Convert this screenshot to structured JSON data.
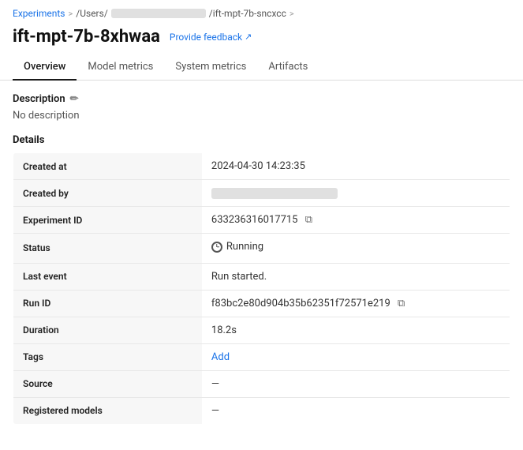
{
  "breadcrumb": {
    "experiments_label": "Experiments",
    "users_label": "/Users/",
    "run_label": "/ift-mpt-7b-sncxcc",
    "sep1": ">",
    "sep2": ">"
  },
  "header": {
    "title": "ift-mpt-7b-8xhwaa",
    "feedback_label": "Provide feedback",
    "feedback_icon": "↗"
  },
  "tabs": [
    {
      "label": "Overview",
      "active": true
    },
    {
      "label": "Model metrics",
      "active": false
    },
    {
      "label": "System metrics",
      "active": false
    },
    {
      "label": "Artifacts",
      "active": false
    }
  ],
  "description": {
    "section_label": "Description",
    "edit_icon": "✏",
    "no_description_text": "No description"
  },
  "details": {
    "section_label": "Details",
    "rows": [
      {
        "key": "Created at",
        "value": "2024-04-30 14:23:35",
        "type": "text"
      },
      {
        "key": "Created by",
        "value": "",
        "type": "blurred"
      },
      {
        "key": "Experiment ID",
        "value": "633236316017715",
        "type": "copy"
      },
      {
        "key": "Status",
        "value": "Running",
        "type": "status"
      },
      {
        "key": "Last event",
        "value": "Run started.",
        "type": "text"
      },
      {
        "key": "Run ID",
        "value": "f83bc2e80d904b35b62351f72571e219",
        "type": "copy"
      },
      {
        "key": "Duration",
        "value": "18.2s",
        "type": "text"
      },
      {
        "key": "Tags",
        "value": "Add",
        "type": "link"
      },
      {
        "key": "Source",
        "value": "—",
        "type": "text"
      },
      {
        "key": "Registered models",
        "value": "—",
        "type": "text"
      }
    ]
  },
  "colors": {
    "accent": "#1a73e8",
    "border": "#ddd",
    "label_bg": "#f7f7f7"
  }
}
